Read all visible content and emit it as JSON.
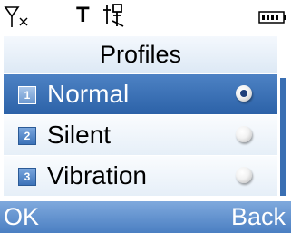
{
  "status": {
    "t_indicator": "T",
    "icons": [
      "signal-off-icon",
      "t-indicator",
      "jp-icon",
      "battery-icon"
    ]
  },
  "title": "Profiles",
  "profiles": [
    {
      "number": "1",
      "label": "Normal",
      "selected": true
    },
    {
      "number": "2",
      "label": "Silent",
      "selected": false
    },
    {
      "number": "3",
      "label": "Vibration",
      "selected": false
    }
  ],
  "softkeys": {
    "left": "OK",
    "right": "Back"
  },
  "colors": {
    "accent": "#2c62a8",
    "header_bg": "#e6eff8",
    "softkey_bg": "#5b8acb"
  }
}
